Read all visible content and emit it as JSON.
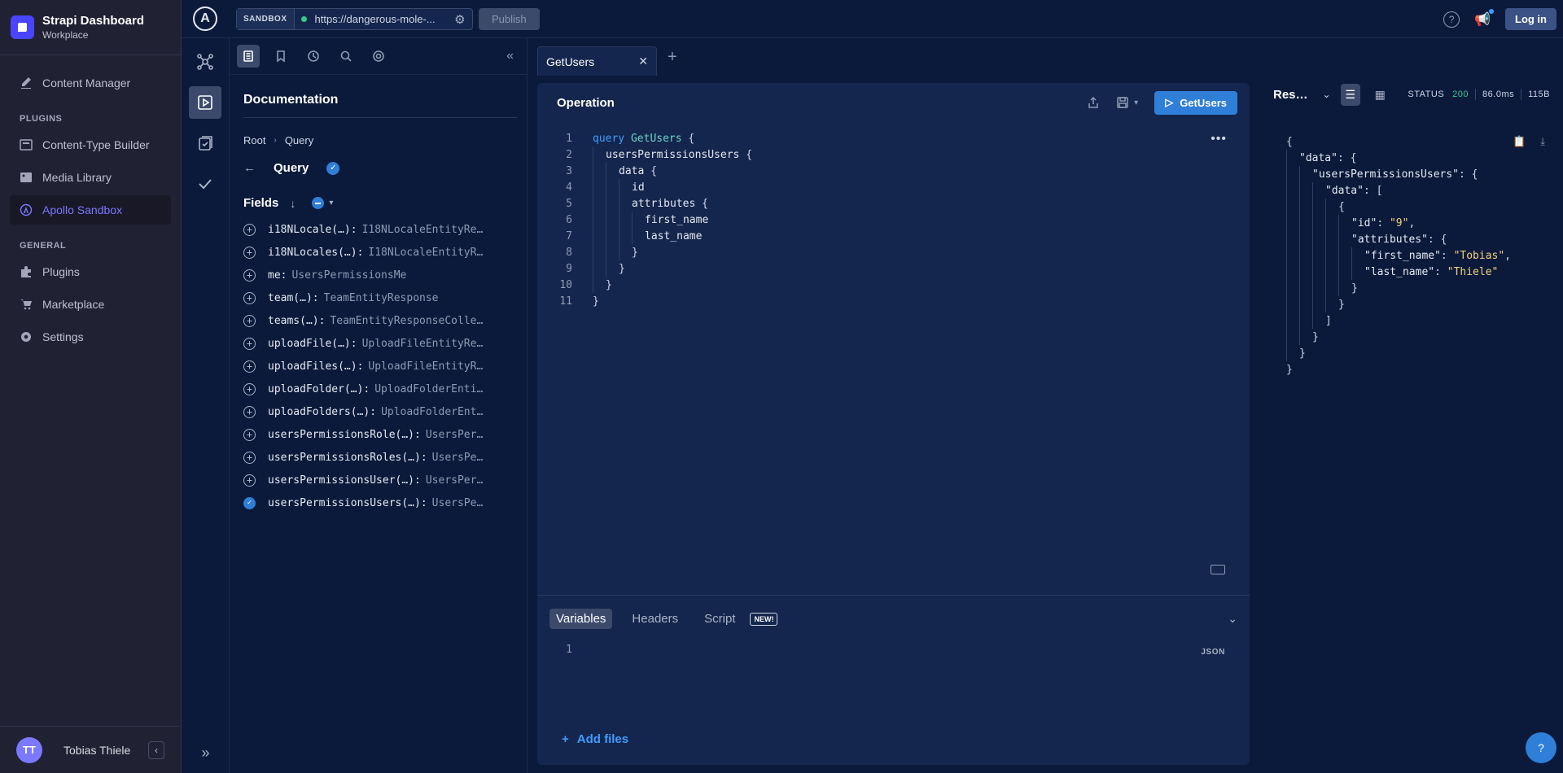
{
  "strapi": {
    "title": "Strapi Dashboard",
    "subtitle": "Workplace",
    "content_manager": "Content Manager",
    "plugins_section": "PLUGINS",
    "plugins_items": [
      "Content-Type Builder",
      "Media Library",
      "Apollo Sandbox"
    ],
    "general_section": "GENERAL",
    "general_items": [
      "Plugins",
      "Marketplace",
      "Settings"
    ],
    "user_initials": "TT",
    "user_name": "Tobias Thiele"
  },
  "topbar": {
    "logo": "A",
    "sandbox_label": "SANDBOX",
    "url": "https://dangerous-mole-...",
    "publish": "Publish",
    "login": "Log in"
  },
  "doc": {
    "title": "Documentation",
    "crumb_root": "Root",
    "crumb_query": "Query",
    "query_label": "Query",
    "fields_label": "Fields",
    "fields": [
      {
        "name": "i18NLocale(…):",
        "type": "I18NLocaleEntityRe…",
        "checked": false
      },
      {
        "name": "i18NLocales(…):",
        "type": "I18NLocaleEntityR…",
        "checked": false
      },
      {
        "name": "me:",
        "type": "UsersPermissionsMe",
        "checked": false
      },
      {
        "name": "team(…):",
        "type": "TeamEntityResponse",
        "checked": false
      },
      {
        "name": "teams(…):",
        "type": "TeamEntityResponseColle…",
        "checked": false
      },
      {
        "name": "uploadFile(…):",
        "type": "UploadFileEntityRe…",
        "checked": false
      },
      {
        "name": "uploadFiles(…):",
        "type": "UploadFileEntityR…",
        "checked": false
      },
      {
        "name": "uploadFolder(…):",
        "type": "UploadFolderEnti…",
        "checked": false
      },
      {
        "name": "uploadFolders(…):",
        "type": "UploadFolderEnt…",
        "checked": false
      },
      {
        "name": "usersPermissionsRole(…):",
        "type": "UsersPer…",
        "checked": false
      },
      {
        "name": "usersPermissionsRoles(…):",
        "type": "UsersPe…",
        "checked": false
      },
      {
        "name": "usersPermissionsUser(…):",
        "type": "UsersPer…",
        "checked": false
      },
      {
        "name": "usersPermissionsUsers(…):",
        "type": "UsersPe…",
        "checked": true
      }
    ]
  },
  "editor": {
    "tab_name": "GetUsers",
    "operation_title": "Operation",
    "run_label": "GetUsers",
    "lines": [
      {
        "n": "1",
        "indent": 0,
        "parts": [
          [
            "kw",
            "query "
          ],
          [
            "opn",
            "GetUsers"
          ],
          [
            "pun",
            " {"
          ]
        ]
      },
      {
        "n": "2",
        "indent": 1,
        "parts": [
          [
            "fld",
            "usersPermissionsUsers"
          ],
          [
            "pun",
            " {"
          ]
        ]
      },
      {
        "n": "3",
        "indent": 2,
        "parts": [
          [
            "fld",
            "data"
          ],
          [
            "pun",
            " {"
          ]
        ]
      },
      {
        "n": "4",
        "indent": 3,
        "parts": [
          [
            "fld",
            "id"
          ]
        ]
      },
      {
        "n": "5",
        "indent": 3,
        "parts": [
          [
            "fld",
            "attributes"
          ],
          [
            "pun",
            " {"
          ]
        ]
      },
      {
        "n": "6",
        "indent": 4,
        "parts": [
          [
            "fld",
            "first_name"
          ]
        ]
      },
      {
        "n": "7",
        "indent": 4,
        "parts": [
          [
            "fld",
            "last_name"
          ]
        ]
      },
      {
        "n": "8",
        "indent": 3,
        "parts": [
          [
            "pun",
            "}"
          ]
        ]
      },
      {
        "n": "9",
        "indent": 2,
        "parts": [
          [
            "pun",
            "}"
          ]
        ]
      },
      {
        "n": "10",
        "indent": 1,
        "parts": [
          [
            "pun",
            "}"
          ]
        ]
      },
      {
        "n": "11",
        "indent": 0,
        "parts": [
          [
            "pun",
            "}"
          ]
        ]
      }
    ],
    "vars_tabs": [
      "Variables",
      "Headers",
      "Script"
    ],
    "new_badge": "NEW!",
    "vars_line": "1",
    "json_label": "JSON",
    "add_files": "Add files"
  },
  "response": {
    "title": "Res…",
    "status_label": "STATUS",
    "status_code": "200",
    "time": "86.0ms",
    "size": "115B",
    "lines": [
      {
        "indent": 0,
        "text": [
          [
            "jp",
            "{"
          ]
        ]
      },
      {
        "indent": 1,
        "text": [
          [
            "jk",
            "\"data\""
          ],
          [
            "jp",
            ": {"
          ]
        ]
      },
      {
        "indent": 2,
        "text": [
          [
            "jk",
            "\"usersPermissionsUsers\""
          ],
          [
            "jp",
            ": {"
          ]
        ]
      },
      {
        "indent": 3,
        "text": [
          [
            "jk",
            "\"data\""
          ],
          [
            "jp",
            ": ["
          ]
        ]
      },
      {
        "indent": 4,
        "text": [
          [
            "jp",
            "{"
          ]
        ]
      },
      {
        "indent": 5,
        "text": [
          [
            "jk",
            "\"id\""
          ],
          [
            "jp",
            ": "
          ],
          [
            "js",
            "\"9\""
          ],
          [
            "jp",
            ","
          ]
        ]
      },
      {
        "indent": 5,
        "text": [
          [
            "jk",
            "\"attributes\""
          ],
          [
            "jp",
            ": {"
          ]
        ]
      },
      {
        "indent": 6,
        "text": [
          [
            "jk",
            "\"first_name\""
          ],
          [
            "jp",
            ": "
          ],
          [
            "js",
            "\"Tobias\""
          ],
          [
            "jp",
            ","
          ]
        ]
      },
      {
        "indent": 6,
        "text": [
          [
            "jk",
            "\"last_name\""
          ],
          [
            "jp",
            ": "
          ],
          [
            "js",
            "\"Thiele\""
          ]
        ]
      },
      {
        "indent": 5,
        "text": [
          [
            "jp",
            "}"
          ]
        ]
      },
      {
        "indent": 4,
        "text": [
          [
            "jp",
            "}"
          ]
        ]
      },
      {
        "indent": 3,
        "text": [
          [
            "jp",
            "]"
          ]
        ]
      },
      {
        "indent": 2,
        "text": [
          [
            "jp",
            "}"
          ]
        ]
      },
      {
        "indent": 1,
        "text": [
          [
            "jp",
            "}"
          ]
        ]
      },
      {
        "indent": 0,
        "text": [
          [
            "jp",
            "}"
          ]
        ]
      }
    ],
    "help": "?"
  }
}
